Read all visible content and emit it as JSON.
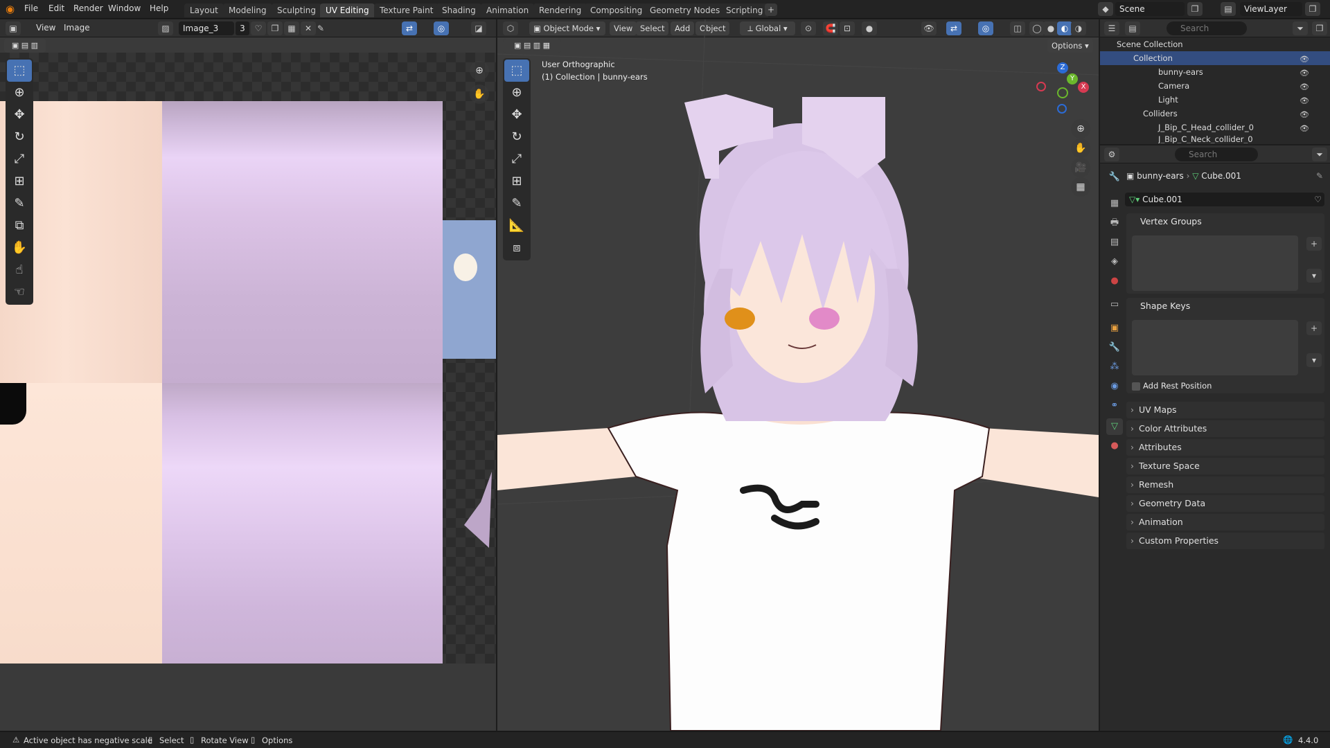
{
  "app": {
    "logo": "blender-icon"
  },
  "menus": [
    "File",
    "Edit",
    "Render",
    "Window",
    "Help"
  ],
  "workspaces": [
    "Layout",
    "Modeling",
    "Sculpting",
    "UV Editing",
    "Texture Paint",
    "Shading",
    "Animation",
    "Rendering",
    "Compositing",
    "Geometry Nodes",
    "Scripting"
  ],
  "active_workspace": "UV Editing",
  "scene": {
    "name": "Scene",
    "viewlayer": "ViewLayer"
  },
  "uv_editor": {
    "view_label": "View",
    "image_label": "Image",
    "image_name": "Image_3",
    "users": "3"
  },
  "viewport": {
    "mode": "Object Mode",
    "menus": [
      "View",
      "Select",
      "Add",
      "Object"
    ],
    "orientation": "Global",
    "options": "Options",
    "overlay_line1": "User Orthographic",
    "overlay_line2": "(1) Collection | bunny-ears",
    "gizmo": {
      "x": "X",
      "y": "Y",
      "z": "Z"
    }
  },
  "outliner": {
    "search_placeholder": "Search",
    "root": "Scene Collection",
    "items": [
      {
        "name": "Collection",
        "indent": 1
      },
      {
        "name": "bunny-ears",
        "indent": 2
      },
      {
        "name": "Camera",
        "indent": 2
      },
      {
        "name": "Light",
        "indent": 2
      },
      {
        "name": "Colliders",
        "indent": 1
      },
      {
        "name": "J_Bip_C_Head_collider_0",
        "indent": 2
      },
      {
        "name": "J_Bip_C_Neck_collider_0",
        "indent": 2
      }
    ]
  },
  "properties": {
    "search_placeholder": "Search",
    "breadcrumb_object": "bunny-ears",
    "breadcrumb_data": "Cube.001",
    "data_name": "Cube.001",
    "vertex_groups": "Vertex Groups",
    "shape_keys": "Shape Keys",
    "add_rest_position": "Add Rest Position",
    "sections": [
      "UV Maps",
      "Color Attributes",
      "Attributes",
      "Texture Space",
      "Remesh",
      "Geometry Data",
      "Animation",
      "Custom Properties"
    ]
  },
  "statusbar": {
    "warning": "Active object has negative scale",
    "select": "Select",
    "rotate": "Rotate View",
    "options": "Options",
    "version": "4.4.0"
  },
  "colors": {
    "accent": "#4772b3",
    "hair": "#e6d2f5",
    "skin": "#fae1d2"
  }
}
